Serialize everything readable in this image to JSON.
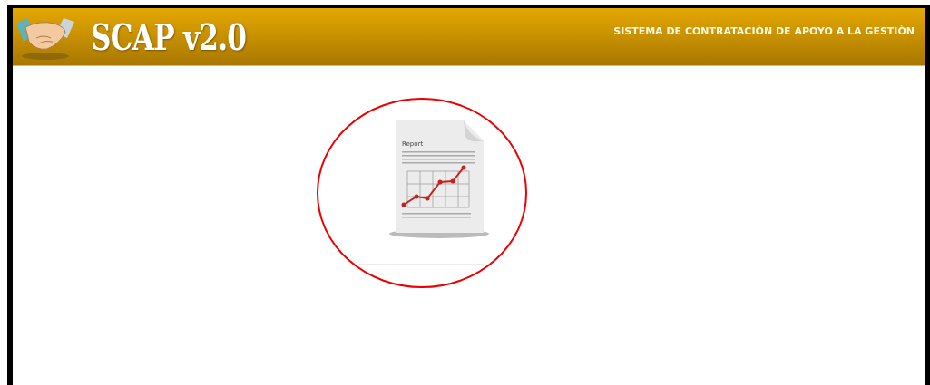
{
  "header": {
    "title": "SCAP v2.0",
    "subtitle": "SISTEMA DE CONTRATACIÒN DE APOYO A LA GESTIÒN"
  },
  "report_tile": {
    "label": "Report",
    "highlighted": true
  }
}
